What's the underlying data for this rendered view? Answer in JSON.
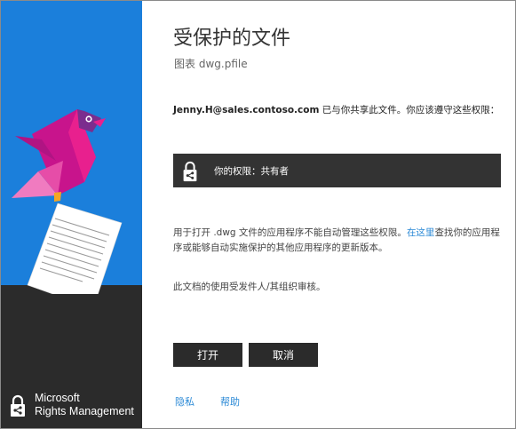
{
  "window": {
    "title": "受保护的文件",
    "file_type_label": "图表",
    "file_name": "dwg.pfile"
  },
  "shared": {
    "user": "Jenny.H@sales.contoso.com",
    "message": " 已与你共享此文件。你应该遵守这些权限："
  },
  "permission": {
    "icon": "rights-lock-icon",
    "text": "你的权限：共有者"
  },
  "info": {
    "text_before": "用于打开 .dwg 文件的应用程序不能自动管理这些权限。",
    "link": "在这里",
    "text_after": "查找你的应用程序或能够自动实施保护的其他应用程序的更新版本。"
  },
  "audit_text": "此文档的使用受发件人/其组织审核。",
  "buttons": {
    "open": "打开",
    "cancel": "取消"
  },
  "footer": {
    "privacy": "隐私",
    "help": "帮助"
  },
  "brand": {
    "line1": "Microsoft",
    "line2": "Rights Management"
  },
  "colors": {
    "panel_blue": "#1b7fdb",
    "panel_dark": "#2b2b2b",
    "link": "#2c8ad6",
    "bird_magenta": "#c8148c",
    "bird_pink": "#e64da8",
    "bird_purple": "#7b2d8e"
  }
}
